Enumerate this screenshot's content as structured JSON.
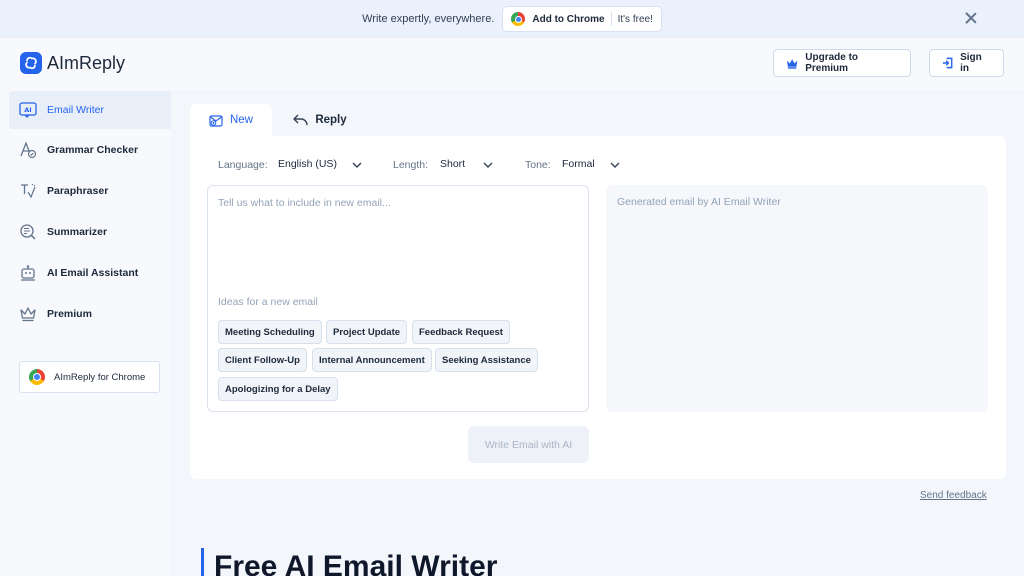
{
  "banner": {
    "text": "Write expertly, everywhere.",
    "cta_label": "Add to Chrome",
    "cta_note": "It's free!"
  },
  "header": {
    "logo_text": "AImReply",
    "upgrade_label": "Upgrade to Premium",
    "signin_label": "Sign in"
  },
  "sidebar": {
    "items": [
      {
        "label": "Email Writer",
        "icon": "ai-icon",
        "active": true
      },
      {
        "label": "Grammar Checker",
        "icon": "grammar-icon",
        "active": false
      },
      {
        "label": "Paraphraser",
        "icon": "paraphrase-icon",
        "active": false
      },
      {
        "label": "Summarizer",
        "icon": "summarize-icon",
        "active": false
      },
      {
        "label": "AI Email Assistant",
        "icon": "robot-icon",
        "active": false
      },
      {
        "label": "Premium",
        "icon": "crown-icon",
        "active": false
      }
    ],
    "chrome_card_label": "AImReply for Chrome"
  },
  "tabs": [
    {
      "label": "New",
      "icon": "compose-icon",
      "active": true
    },
    {
      "label": "Reply",
      "icon": "reply-icon",
      "active": false
    }
  ],
  "options": {
    "language_label": "Language:",
    "language_value": "English (US)",
    "length_label": "Length:",
    "length_value": "Short",
    "tone_label": "Tone:",
    "tone_value": "Formal"
  },
  "input": {
    "placeholder": "Tell us what to include in new email...",
    "ideas_label": "Ideas for a new email",
    "chips": [
      "Meeting Scheduling",
      "Project Update",
      "Feedback Request",
      "Client Follow-Up",
      "Internal Announcement",
      "Seeking Assistance",
      "Apologizing for a Delay"
    ]
  },
  "output": {
    "placeholder": "Generated email by AI Email Writer"
  },
  "write_button_label": "Write Email with AI",
  "feedback_label": "Send feedback",
  "hero_title": "Free AI Email Writer",
  "colors": {
    "accent": "#2563eb",
    "banner_bg": "#eaf1fd",
    "sidebar_bg": "#f7f9fd",
    "main_bg": "#f3f6fb"
  }
}
